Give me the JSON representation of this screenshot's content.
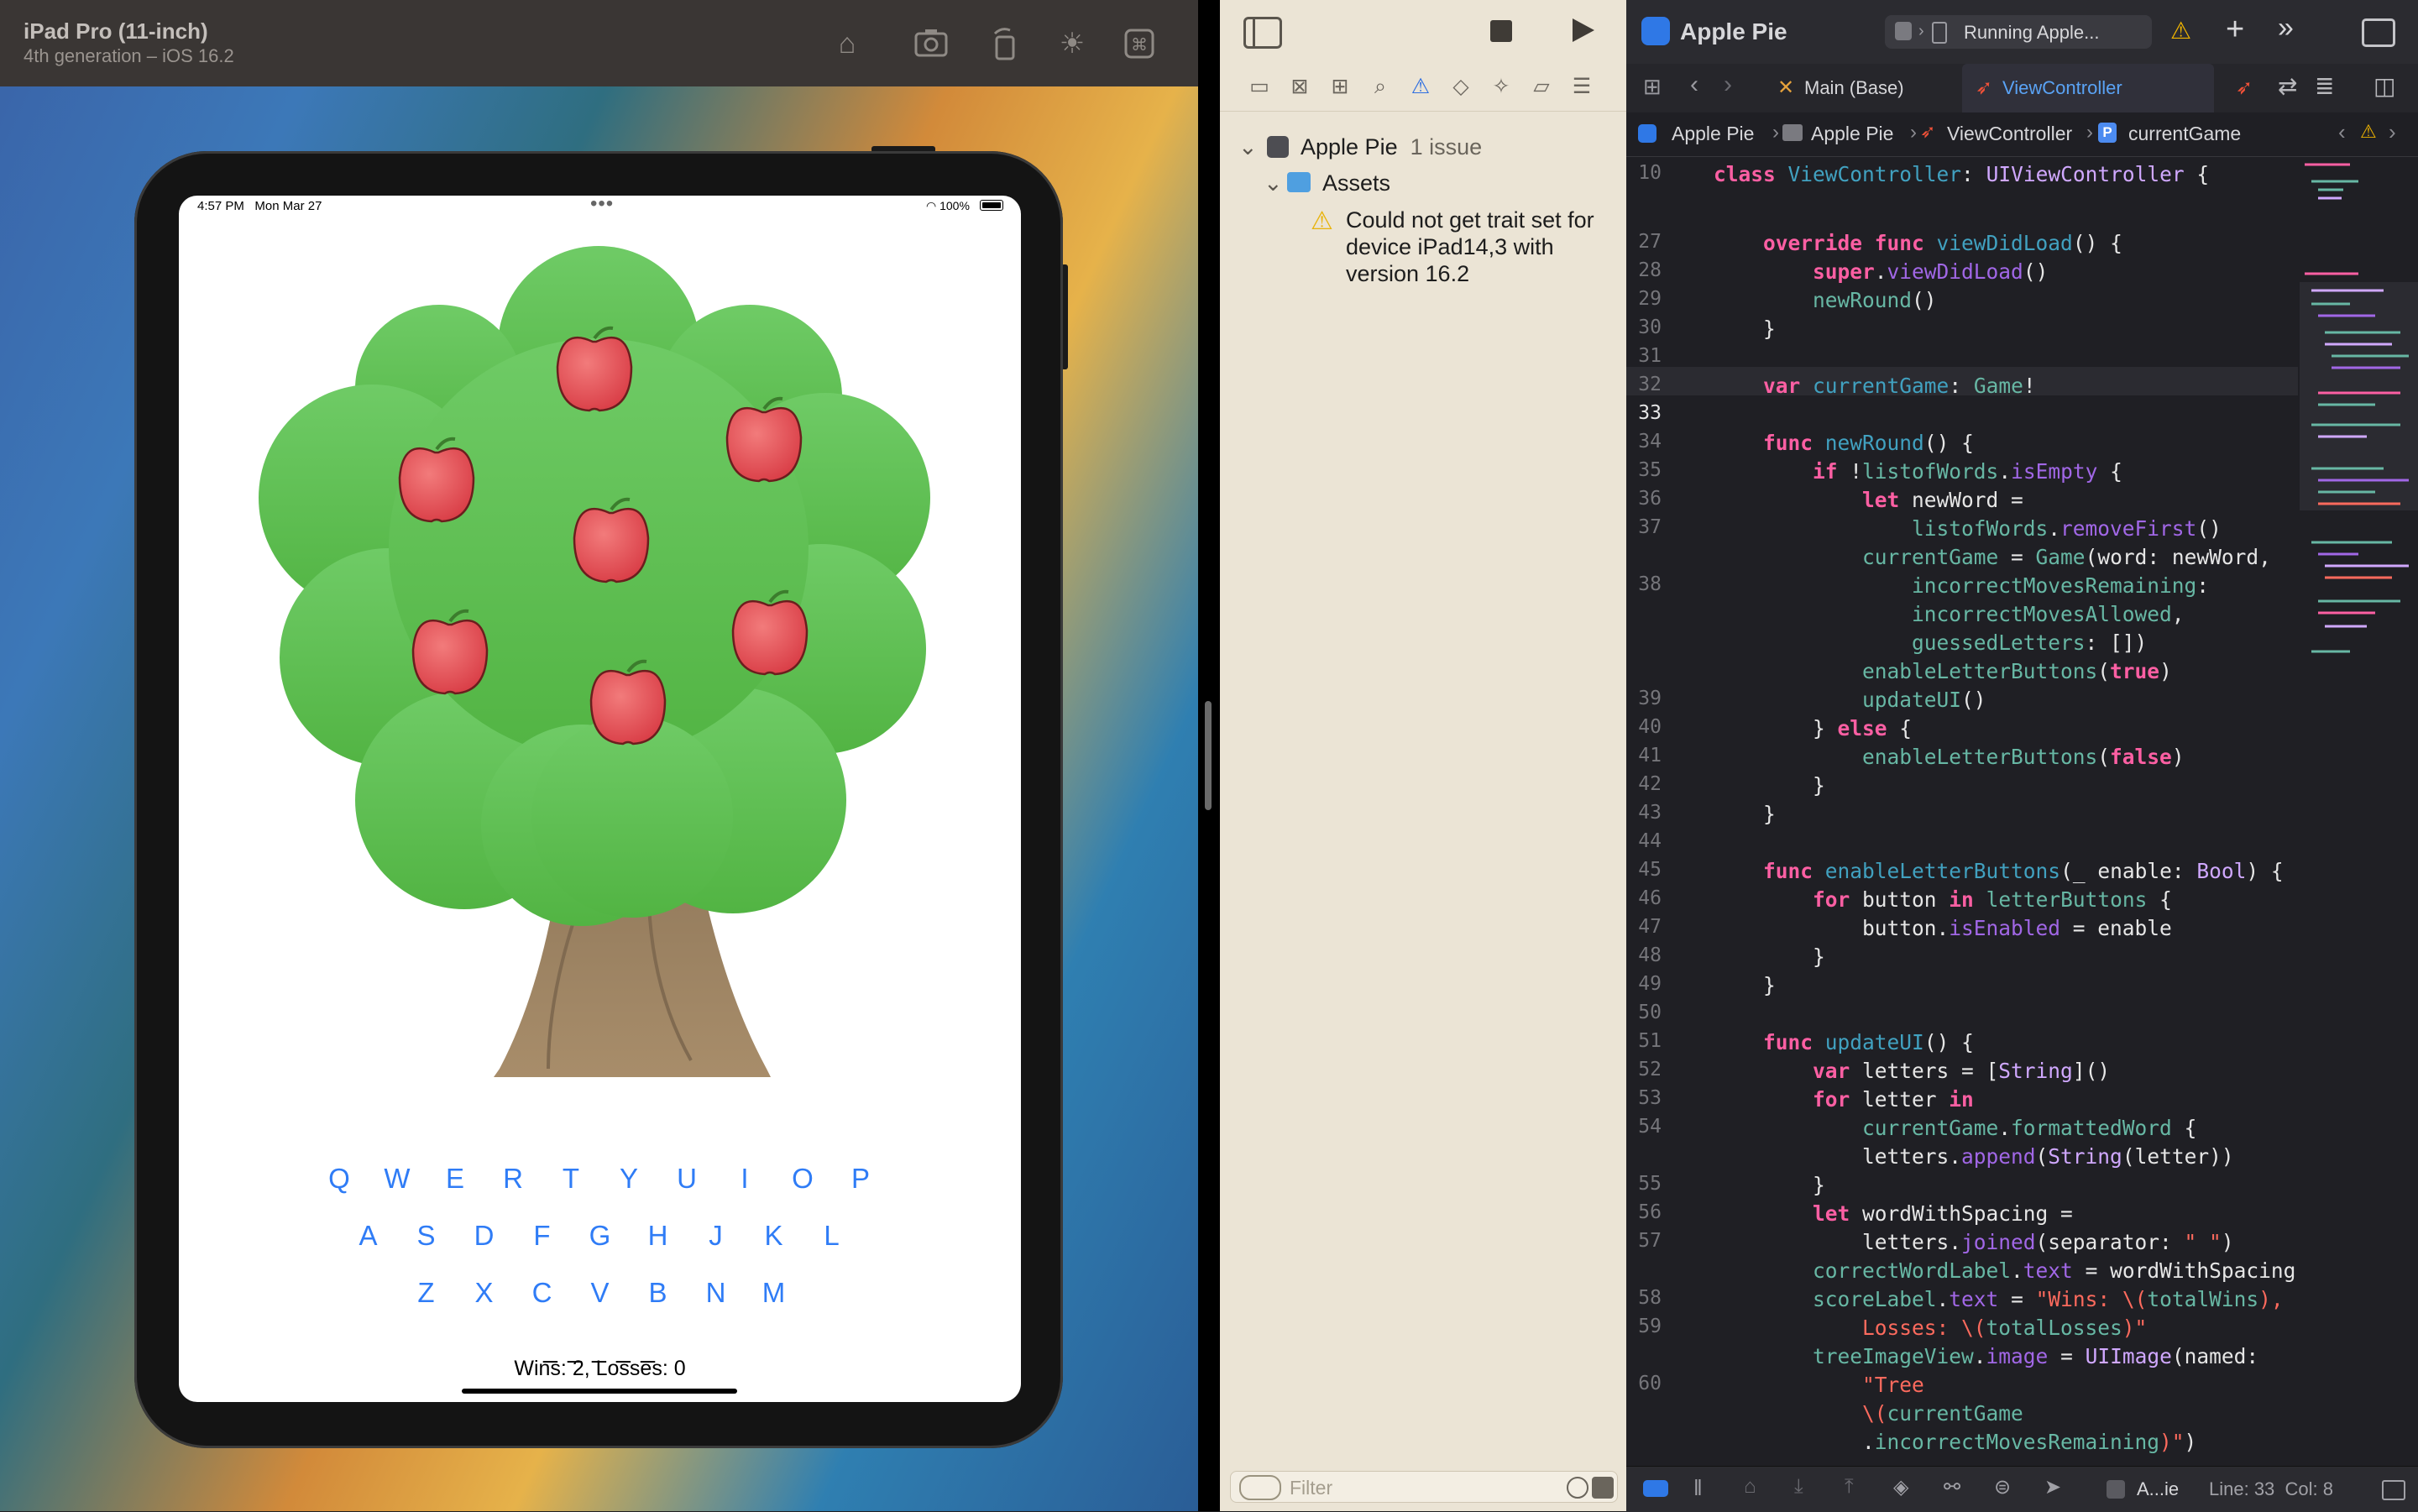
{
  "simulator": {
    "title": "iPad Pro (11-inch)",
    "subtitle": "4th generation – iOS 16.2",
    "toolbar_icons": [
      "home-icon",
      "screenshot-icon",
      "rotate-icon",
      "appearance-icon",
      "command-icon"
    ],
    "status": {
      "time": "4:57 PM",
      "date": "Mon Mar 27",
      "battery": "100%"
    },
    "app": {
      "keyboard_rows": [
        [
          "Q",
          "W",
          "E",
          "R",
          "T",
          "Y",
          "U",
          "I",
          "O",
          "P"
        ],
        [
          "A",
          "S",
          "D",
          "F",
          "G",
          "H",
          "J",
          "K",
          "L"
        ],
        [
          "Z",
          "X",
          "C",
          "V",
          "B",
          "N",
          "M"
        ]
      ],
      "word": "_ _ _ _ _",
      "score": "Wins: 2, Losses: 0",
      "key_color": "#2f7cf6",
      "apples_count": 7
    }
  },
  "navigator": {
    "project": "Apple Pie",
    "project_issues": "1 issue",
    "group": "Assets",
    "issue_text": "Could not get trait set for device iPad14,3 with version 16.2",
    "filter_placeholder": "Filter"
  },
  "editor": {
    "window_title": "Apple Pie",
    "run_status": "Running Apple...",
    "tabs": [
      {
        "label": "Main (Base)",
        "active": false
      },
      {
        "label": "ViewController",
        "active": true
      }
    ],
    "breadcrumb": [
      "Apple Pie",
      "Apple Pie",
      "ViewController",
      "currentGame"
    ],
    "gutter": [
      "10",
      "27",
      "28",
      "29",
      "30",
      "31",
      "32",
      "33",
      "34",
      "35",
      "36",
      "37",
      "",
      "38",
      "",
      "",
      "",
      "39",
      "40",
      "41",
      "42",
      "43",
      "44",
      "45",
      "46",
      "47",
      "48",
      "49",
      "50",
      "51",
      "52",
      "53",
      "54",
      "",
      "55",
      "56",
      "57",
      "",
      "58",
      "59",
      "",
      "60",
      "",
      "",
      "",
      ""
    ],
    "current_line": "33",
    "footer": {
      "scheme": "A...ie",
      "position": "Line: 33  Col: 8"
    }
  }
}
